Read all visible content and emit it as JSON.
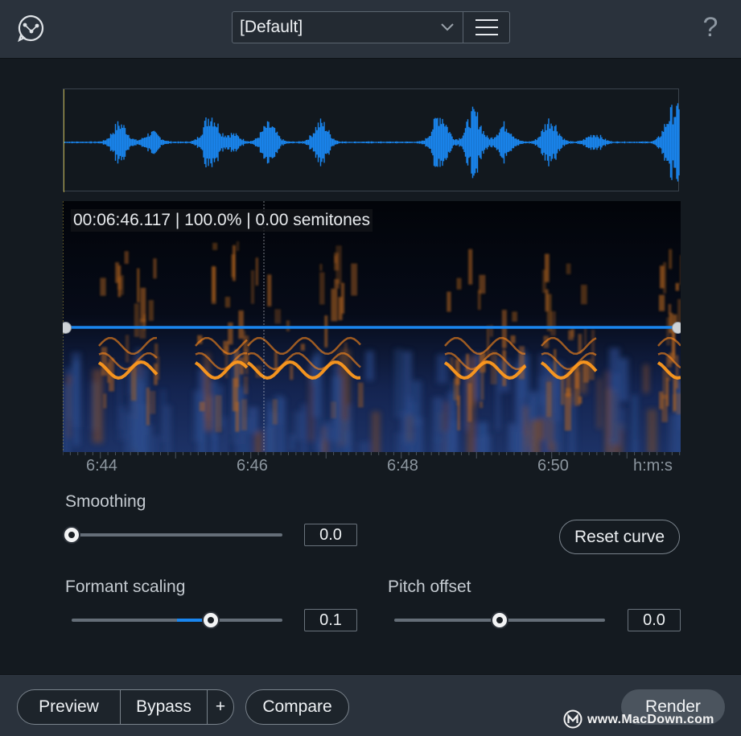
{
  "header": {
    "preset_value": "[Default]",
    "help_label": "?"
  },
  "spectrogram": {
    "readout": "00:06:46.117 | 100.0% | 0.00 semitones"
  },
  "timeline": {
    "labels": [
      "6:44",
      "6:46",
      "6:48",
      "6:50",
      "h:m:s"
    ]
  },
  "smoothing": {
    "label": "Smoothing",
    "value": "0.0",
    "level": 0.0
  },
  "reset_curve": {
    "label": "Reset curve"
  },
  "formant_scaling": {
    "label": "Formant scaling",
    "value": "0.1",
    "level": 0.66
  },
  "pitch_offset": {
    "label": "Pitch offset",
    "value": "0.0",
    "level": 0.5
  },
  "footer": {
    "preview_label": "Preview",
    "bypass_label": "Bypass",
    "add_label": "+",
    "compare_label": "Compare",
    "render_label": "Render"
  },
  "watermark": {
    "text": "www.MacDown.com"
  },
  "colors": {
    "waveform": "#1a86ef",
    "curve": "#1a86ef",
    "spectrogram_hot": "#ff9a1e",
    "spectrogram_cool": "#2b4a8a"
  },
  "icons": {
    "logo": "app-logo-icon",
    "chevron": "chevron-down-icon",
    "menu": "hamburger-menu-icon",
    "help": "help-icon"
  }
}
